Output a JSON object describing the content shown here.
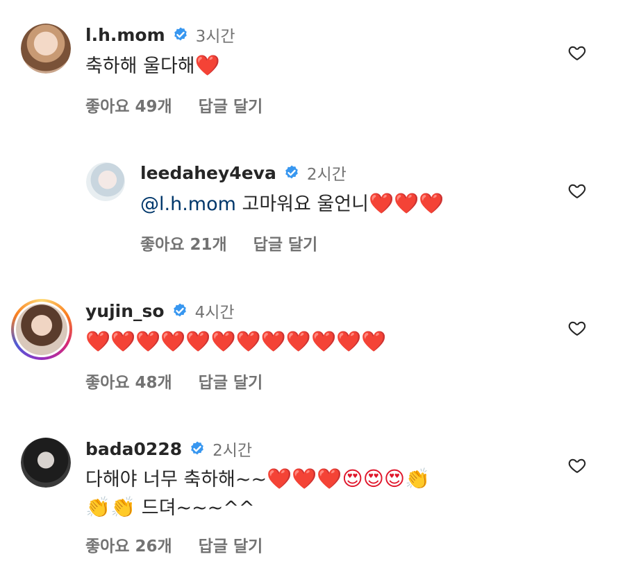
{
  "comments": [
    {
      "username": "l.h.mom",
      "time": "3시간",
      "text_parts": [
        {
          "type": "text",
          "value": "축하해 울다해"
        },
        {
          "type": "emoji",
          "value": "❤️"
        }
      ],
      "likes_label": "좋아요 49개",
      "reply_label": "답글 달기"
    },
    {
      "username": "leedahey4eva",
      "time": "2시간",
      "text_parts": [
        {
          "type": "mention",
          "value": "@l.h.mom"
        },
        {
          "type": "text",
          "value": " 고마워요 울언니"
        },
        {
          "type": "emoji",
          "value": "❤️❤️❤️"
        }
      ],
      "likes_label": "좋아요 21개",
      "reply_label": "답글 달기"
    },
    {
      "username": "yujin_so",
      "time": "4시간",
      "text_parts": [
        {
          "type": "emoji",
          "value": "❤️❤️❤️❤️❤️❤️❤️❤️❤️❤️❤️❤️"
        }
      ],
      "likes_label": "좋아요 48개",
      "reply_label": "답글 달기"
    },
    {
      "username": "bada0228",
      "time": "2시간",
      "line1": [
        {
          "type": "text",
          "value": "다해야 너무 축하해~~"
        },
        {
          "type": "emoji",
          "value": "❤️❤️❤️😍😍😍👏"
        }
      ],
      "line2": [
        {
          "type": "emoji",
          "value": "👏👏"
        },
        {
          "type": "text",
          "value": " 드뎌~~~^^"
        }
      ],
      "likes_label": "좋아요 26개",
      "reply_label": "답글 달기"
    }
  ],
  "icons": {
    "verified": "verified-badge-icon",
    "like": "heart-outline-icon"
  },
  "colors": {
    "username": "#262626",
    "secondary": "#737373",
    "mention": "#00376b",
    "verified": "#3897f0"
  }
}
